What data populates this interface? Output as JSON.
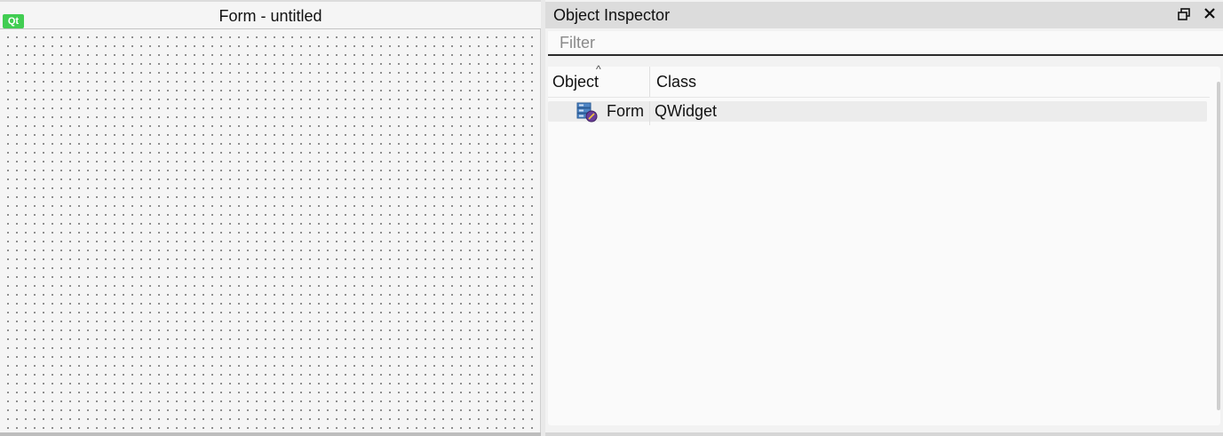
{
  "form": {
    "badge": "Qt",
    "title": "Form - untitled"
  },
  "inspector": {
    "title": "Object Inspector",
    "float_icon": "float-restore-icon",
    "close_icon": "close-icon",
    "filter": {
      "placeholder": "Filter",
      "value": ""
    },
    "columns": {
      "object": "Object",
      "class": "Class"
    },
    "sort_indicator": "^",
    "rows": [
      {
        "object": "Form",
        "class": "QWidget",
        "icon": "widget-form-icon"
      }
    ]
  },
  "colors": {
    "qt_badge": "#41cd52",
    "canvas_dots": "#4a4a4a",
    "titlebar": "#dcdcdc"
  }
}
